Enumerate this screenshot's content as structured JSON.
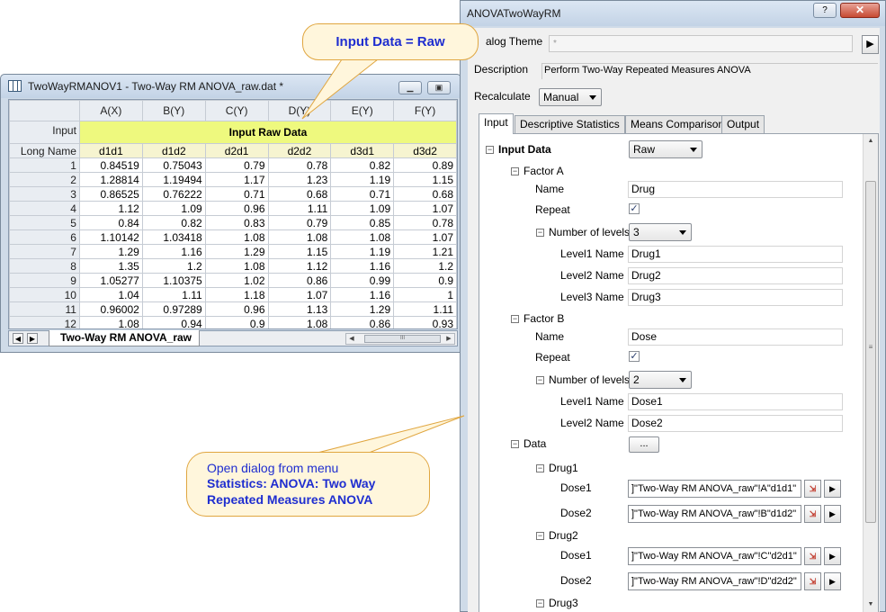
{
  "worksheet": {
    "title": "TwoWayRMANOV1 - Two-Way RM ANOVA_raw.dat *",
    "columns": [
      "A(X)",
      "B(Y)",
      "C(Y)",
      "D(Y)",
      "E(Y)",
      "F(Y)"
    ],
    "input_row_label": "Input",
    "input_annotation": "Input Raw Data",
    "long_name_label": "Long Name",
    "long_names": [
      "d1d1",
      "d1d2",
      "d2d1",
      "d2d2",
      "d3d1",
      "d3d2"
    ],
    "rows": [
      {
        "n": "1",
        "vals": [
          "0.84519",
          "0.75043",
          "0.79",
          "0.78",
          "0.82",
          "0.89"
        ]
      },
      {
        "n": "2",
        "vals": [
          "1.28814",
          "1.19494",
          "1.17",
          "1.23",
          "1.19",
          "1.15"
        ]
      },
      {
        "n": "3",
        "vals": [
          "0.86525",
          "0.76222",
          "0.71",
          "0.68",
          "0.71",
          "0.68"
        ]
      },
      {
        "n": "4",
        "vals": [
          "1.12",
          "1.09",
          "0.96",
          "1.11",
          "1.09",
          "1.07"
        ]
      },
      {
        "n": "5",
        "vals": [
          "0.84",
          "0.82",
          "0.83",
          "0.79",
          "0.85",
          "0.78"
        ]
      },
      {
        "n": "6",
        "vals": [
          "1.10142",
          "1.03418",
          "1.08",
          "1.08",
          "1.08",
          "1.07"
        ]
      },
      {
        "n": "7",
        "vals": [
          "1.29",
          "1.16",
          "1.29",
          "1.15",
          "1.19",
          "1.21"
        ]
      },
      {
        "n": "8",
        "vals": [
          "1.35",
          "1.2",
          "1.08",
          "1.12",
          "1.16",
          "1.2"
        ]
      },
      {
        "n": "9",
        "vals": [
          "1.05277",
          "1.10375",
          "1.02",
          "0.86",
          "0.99",
          "0.9"
        ]
      },
      {
        "n": "10",
        "vals": [
          "1.04",
          "1.11",
          "1.18",
          "1.07",
          "1.16",
          "1"
        ]
      },
      {
        "n": "11",
        "vals": [
          "0.96002",
          "0.97289",
          "0.96",
          "1.13",
          "1.29",
          "1.11"
        ]
      },
      {
        "n": "12",
        "vals": [
          "1.08",
          "0.94",
          "0.9",
          "1.08",
          "0.86",
          "0.93"
        ]
      }
    ],
    "sheet_tab": "Two-Way RM ANOVA_raw",
    "colors": {
      "annotation_bg": "#eef97e",
      "long_name_bg": "#f6f4d0"
    }
  },
  "dialog": {
    "title": "ANOVATwoWayRM",
    "help_glyph": "?",
    "close_glyph": "✕",
    "theme_label": "alog Theme",
    "theme_value": "*",
    "description_label": "Description",
    "description_value": "Perform Two-Way Repeated Measures ANOVA",
    "recalculate_label": "Recalculate",
    "recalculate_value": "Manual",
    "tabs": [
      "Input",
      "Descriptive Statistics",
      "Means Comparison",
      "Output"
    ],
    "input_data_label": "Input Data",
    "input_data_value": "Raw",
    "factor_a": {
      "label": "Factor A",
      "name_label": "Name",
      "name_value": "Drug",
      "repeat_label": "Repeat",
      "levels_label": "Number of levels",
      "levels_value": "3",
      "level_labels": [
        "Level1 Name",
        "Level2 Name",
        "Level3 Name"
      ],
      "level_values": [
        "Drug1",
        "Drug2",
        "Drug3"
      ]
    },
    "factor_b": {
      "label": "Factor B",
      "name_label": "Name",
      "name_value": "Dose",
      "repeat_label": "Repeat",
      "levels_label": "Number of levels",
      "levels_value": "2",
      "level_labels": [
        "Level1 Name",
        "Level2 Name"
      ],
      "level_values": [
        "Dose1",
        "Dose2"
      ]
    },
    "data_label": "Data",
    "data_button": "...",
    "drug1": "Drug1",
    "drug2": "Drug2",
    "drug3": "Drug3",
    "dose1_label": "Dose1",
    "dose2_label": "Dose2",
    "ranges": [
      "]\"Two-Way RM ANOVA_raw\"!A\"d1d1\"",
      "]\"Two-Way RM ANOVA_raw\"!B\"d1d2\"",
      "]\"Two-Way RM ANOVA_raw\"!C\"d2d1\"",
      "]\"Two-Way RM ANOVA_raw\"!D\"d2d2\""
    ]
  },
  "callouts": {
    "top": "Input Data = Raw",
    "bottom_line1": "Open dialog from menu",
    "bottom_line2": "Statistics: ANOVA: Two Way",
    "bottom_line3": "Repeated Measures ANOVA",
    "text_color": "#1f2ed0",
    "bg_color": "#fff6dc",
    "border_color": "#e0a640"
  }
}
